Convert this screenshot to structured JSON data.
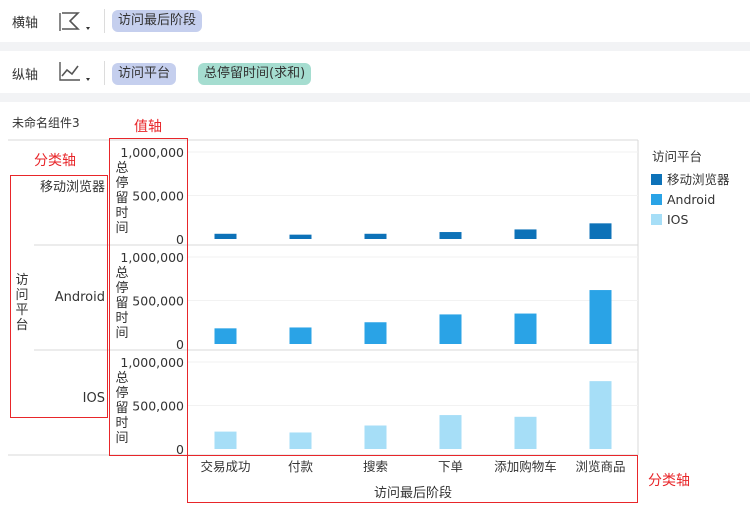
{
  "toolbar": {
    "x_axis": {
      "label": "横轴",
      "chart_type_icon": "chart-type-icon",
      "fields": [
        "访问最后阶段"
      ]
    },
    "y_axis": {
      "label": "纵轴",
      "chart_type_icon": "line-chart-icon",
      "fields": [
        "访问平台",
        "总停留时间(求和)"
      ]
    }
  },
  "component_title": "未命名组件3",
  "annotations": {
    "value_axis": "值轴",
    "category_axis_left": "分类轴",
    "category_axis_bottom": "分类轴"
  },
  "colors": {
    "annotation": "#e8262a",
    "mobile": "#0d72b8",
    "android": "#2aa3e6",
    "ios": "#a6def7"
  },
  "chart_data": {
    "type": "bar",
    "categories": [
      "交易成功",
      "付款",
      "搜索",
      "下单",
      "添加购物车",
      "浏览商品"
    ],
    "xlabel": "访问最后阶段",
    "ylabel": "总停留时间",
    "row_axis_title": "访问平台",
    "ylim": [
      0,
      1000000
    ],
    "yticks": [
      "1,000,000",
      "500,000",
      "0"
    ],
    "legend": {
      "title": "访问平台",
      "position": "right"
    },
    "series": [
      {
        "name": "移动浏览器",
        "values": [
          60000,
          50000,
          60000,
          80000,
          110000,
          180000
        ]
      },
      {
        "name": "Android",
        "values": [
          180000,
          190000,
          250000,
          340000,
          350000,
          620000
        ]
      },
      {
        "name": "IOS",
        "values": [
          200000,
          190000,
          270000,
          390000,
          370000,
          780000
        ]
      }
    ]
  }
}
